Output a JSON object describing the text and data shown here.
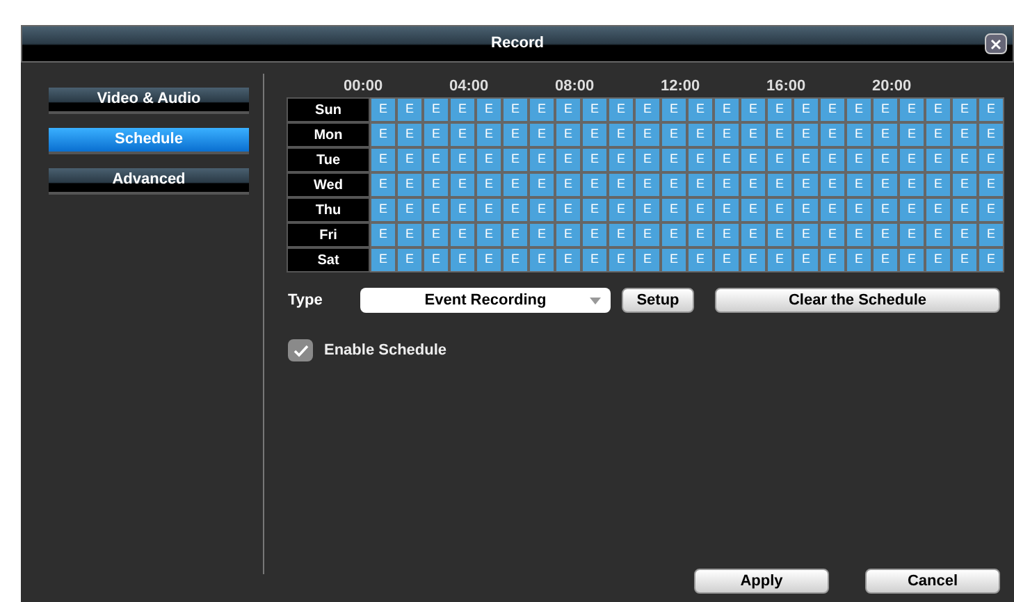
{
  "window": {
    "title": "Record"
  },
  "sidebar": {
    "items": [
      {
        "label": "Video & Audio",
        "selected": false
      },
      {
        "label": "Schedule",
        "selected": true
      },
      {
        "label": "Advanced",
        "selected": false
      }
    ]
  },
  "schedule": {
    "time_labels": [
      "00:00",
      "04:00",
      "08:00",
      "12:00",
      "16:00",
      "20:00"
    ],
    "rows": [
      {
        "day": "Sun",
        "cells": [
          "E",
          "E",
          "E",
          "E",
          "E",
          "E",
          "E",
          "E",
          "E",
          "E",
          "E",
          "E",
          "E",
          "E",
          "E",
          "E",
          "E",
          "E",
          "E",
          "E",
          "E",
          "E",
          "E",
          "E"
        ]
      },
      {
        "day": "Mon",
        "cells": [
          "E",
          "E",
          "E",
          "E",
          "E",
          "E",
          "E",
          "E",
          "E",
          "E",
          "E",
          "E",
          "E",
          "E",
          "E",
          "E",
          "E",
          "E",
          "E",
          "E",
          "E",
          "E",
          "E",
          "E"
        ]
      },
      {
        "day": "Tue",
        "cells": [
          "E",
          "E",
          "E",
          "E",
          "E",
          "E",
          "E",
          "E",
          "E",
          "E",
          "E",
          "E",
          "E",
          "E",
          "E",
          "E",
          "E",
          "E",
          "E",
          "E",
          "E",
          "E",
          "E",
          "E"
        ]
      },
      {
        "day": "Wed",
        "cells": [
          "E",
          "E",
          "E",
          "E",
          "E",
          "E",
          "E",
          "E",
          "E",
          "E",
          "E",
          "E",
          "E",
          "E",
          "E",
          "E",
          "E",
          "E",
          "E",
          "E",
          "E",
          "E",
          "E",
          "E"
        ]
      },
      {
        "day": "Thu",
        "cells": [
          "E",
          "E",
          "E",
          "E",
          "E",
          "E",
          "E",
          "E",
          "E",
          "E",
          "E",
          "E",
          "E",
          "E",
          "E",
          "E",
          "E",
          "E",
          "E",
          "E",
          "E",
          "E",
          "E",
          "E"
        ]
      },
      {
        "day": "Fri",
        "cells": [
          "E",
          "E",
          "E",
          "E",
          "E",
          "E",
          "E",
          "E",
          "E",
          "E",
          "E",
          "E",
          "E",
          "E",
          "E",
          "E",
          "E",
          "E",
          "E",
          "E",
          "E",
          "E",
          "E",
          "E"
        ]
      },
      {
        "day": "Sat",
        "cells": [
          "E",
          "E",
          "E",
          "E",
          "E",
          "E",
          "E",
          "E",
          "E",
          "E",
          "E",
          "E",
          "E",
          "E",
          "E",
          "E",
          "E",
          "E",
          "E",
          "E",
          "E",
          "E",
          "E",
          "E"
        ]
      }
    ]
  },
  "type": {
    "label": "Type",
    "value": "Event Recording"
  },
  "buttons_row": [
    "Setup",
    "Clear the Schedule"
  ],
  "enable_schedule": {
    "label": "Enable Schedule",
    "checked": true
  },
  "footer_buttons": [
    "Apply",
    "Cancel"
  ]
}
